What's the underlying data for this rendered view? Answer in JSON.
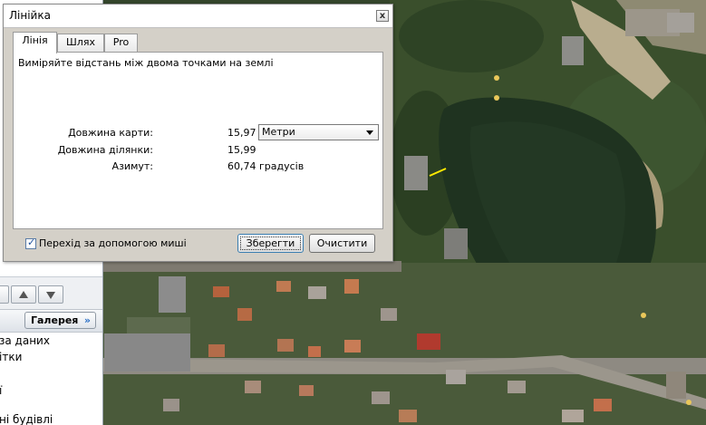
{
  "dialog": {
    "title": "Лінійка",
    "close_glyph": "x",
    "tabs": [
      "Лінія",
      "Шлях",
      "Pro"
    ],
    "active_tab": 0,
    "description": "Виміряйте відстань між двома точками на землі",
    "map_length_label": "Довжина карти:",
    "map_length_value": "15,97",
    "unit_selected": "Метри",
    "ground_length_label": "Довжина ділянки:",
    "ground_length_value": "15,99",
    "azimuth_label": "Азимут:",
    "azimuth_value": "60,74 градусів",
    "mouse_nav_label": "Перехід за допомогою миші",
    "mouse_nav_checked": true,
    "save_button": "Зберегти",
    "clear_button": "Очистити"
  },
  "left_panel": {
    "gallery_button": "Галерея",
    "gallery_chevron": "»",
    "items": [
      "за даних",
      "ітки",
      "ї",
      "ні будівлі"
    ]
  },
  "colors": {
    "dialog_bg": "#d4d0c8",
    "water": "#1f3320",
    "measure_line": "#ffea00",
    "accent": "#2b6fc6"
  },
  "icons": {
    "up": "arrow-up-icon",
    "down": "arrow-down-icon",
    "close": "close-icon",
    "check": "checkmark-icon"
  }
}
